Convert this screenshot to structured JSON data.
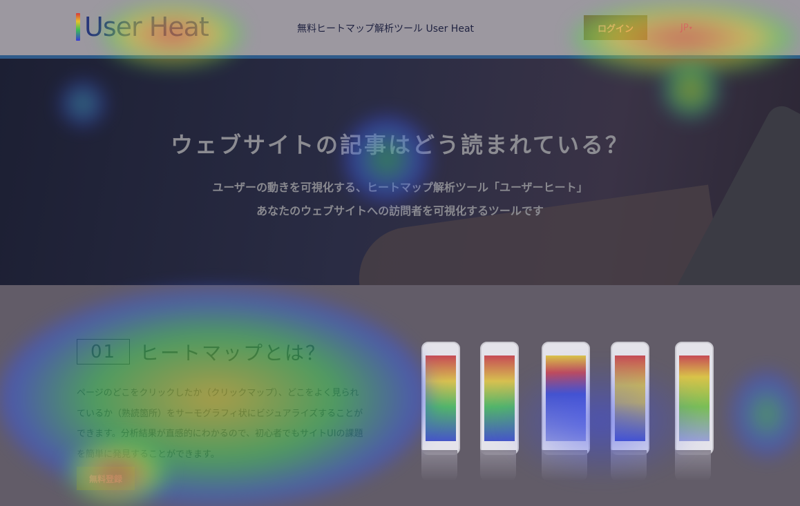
{
  "header": {
    "logo_text": "User Heat",
    "tagline": "無料ヒートマップ解析ツール User Heat",
    "login_label": "ログイン",
    "lang_label": "JP",
    "lang_caret": "▾"
  },
  "hero": {
    "title": "ウェブサイトの記事はどう読まれている？",
    "subtitle_line1": "ユーザーの動きを可視化する、ヒートマップ解析ツール「ユーザーヒート」",
    "subtitle_line2": "あなたのウェブサイトへの訪問者を可視化するツールです"
  },
  "section1": {
    "number": "01",
    "title": "ヒートマップとは？",
    "description_lines": [
      "ページのどこをクリックしたか（クリックマップ）、どこをよく見られ",
      "ているか（熟読箇所）をサーモグラフィ状にビジュアライズすることが",
      "できます。分析結果が直感的にわかるので、初心者でもサイトUIの課題",
      "を簡単に発見することができます。"
    ],
    "signup_label": "無料登録"
  },
  "colors": {
    "heat_red": "#e8412f",
    "heat_yellow": "#e8d12f",
    "heat_green": "#3fd05a",
    "heat_blue": "#3b4cf0",
    "header_rule": "#2f5b8a"
  }
}
